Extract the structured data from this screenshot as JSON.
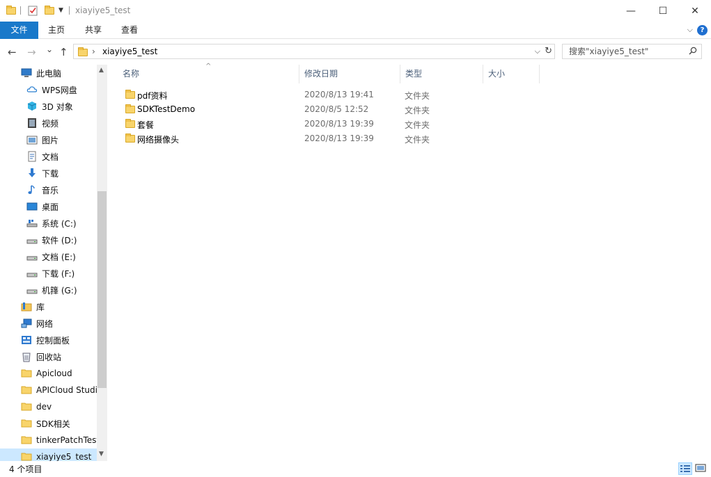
{
  "window": {
    "title": "xiayiye5_test",
    "minimize_glyph": "—",
    "maximize_glyph": "☐",
    "close_glyph": "✕"
  },
  "ribbon": {
    "tabs": [
      "文件",
      "主页",
      "共享",
      "查看"
    ],
    "collapse_glyph": "⌵",
    "help_glyph": "?"
  },
  "nav": {
    "back_glyph": "←",
    "forward_glyph": "→",
    "recent_glyph": "⌄",
    "up_glyph": "↑"
  },
  "address": {
    "separator": "›",
    "crumb": "xiayiye5_test",
    "dropdown_glyph": "⌵",
    "refresh_glyph": "↻"
  },
  "search": {
    "placeholder": "搜索\"xiayiye5_test\""
  },
  "sidebar": {
    "items": [
      {
        "label": "此电脑",
        "icon": "pc-icon"
      },
      {
        "label": "WPS网盘",
        "icon": "cloud-icon"
      },
      {
        "label": "3D 对象",
        "icon": "3d-objects-icon"
      },
      {
        "label": "视频",
        "icon": "video-icon"
      },
      {
        "label": "图片",
        "icon": "pictures-icon"
      },
      {
        "label": "文档",
        "icon": "documents-icon"
      },
      {
        "label": "下载",
        "icon": "downloads-icon"
      },
      {
        "label": "音乐",
        "icon": "music-icon"
      },
      {
        "label": "桌面",
        "icon": "desktop-icon"
      },
      {
        "label": "系统 (C:)",
        "icon": "system-drive-icon"
      },
      {
        "label": "软件 (D:)",
        "icon": "drive-icon"
      },
      {
        "label": "文档 (E:)",
        "icon": "drive-icon"
      },
      {
        "label": "下载 (F:)",
        "icon": "drive-icon"
      },
      {
        "label": "机箨 (G:)",
        "icon": "drive-icon"
      },
      {
        "label": "库",
        "icon": "library-icon"
      },
      {
        "label": "网络",
        "icon": "network-icon"
      },
      {
        "label": "控制面板",
        "icon": "control-panel-icon"
      },
      {
        "label": "回收站",
        "icon": "recycle-bin-icon"
      },
      {
        "label": "Apicloud",
        "icon": "folder-icon"
      },
      {
        "label": "APICloud Studio",
        "icon": "folder-icon"
      },
      {
        "label": "dev",
        "icon": "folder-icon"
      },
      {
        "label": "SDK相关",
        "icon": "folder-icon"
      },
      {
        "label": "tinkerPatchTest",
        "icon": "folder-icon"
      },
      {
        "label": "xiayiye5_test",
        "icon": "folder-icon",
        "selected": true
      }
    ],
    "scroll_up_glyph": "▲",
    "scroll_down_glyph": "▼"
  },
  "columns": [
    "名称",
    "修改日期",
    "类型",
    "大小"
  ],
  "sort_glyph": "^",
  "files": [
    {
      "name": "pdf资料",
      "date": "2020/8/13 19:41",
      "type": "文件夹"
    },
    {
      "name": "SDKTestDemo",
      "date": "2020/8/5 12:52",
      "type": "文件夹"
    },
    {
      "name": "套餐",
      "date": "2020/8/13 19:39",
      "type": "文件夹"
    },
    {
      "name": "网络摄像头",
      "date": "2020/8/13 19:39",
      "type": "文件夹"
    }
  ],
  "status": {
    "item_count": "4 个项目"
  },
  "colors": {
    "accent": "#1979ca",
    "selection": "#cce8ff",
    "folder": "#f8d46b"
  }
}
